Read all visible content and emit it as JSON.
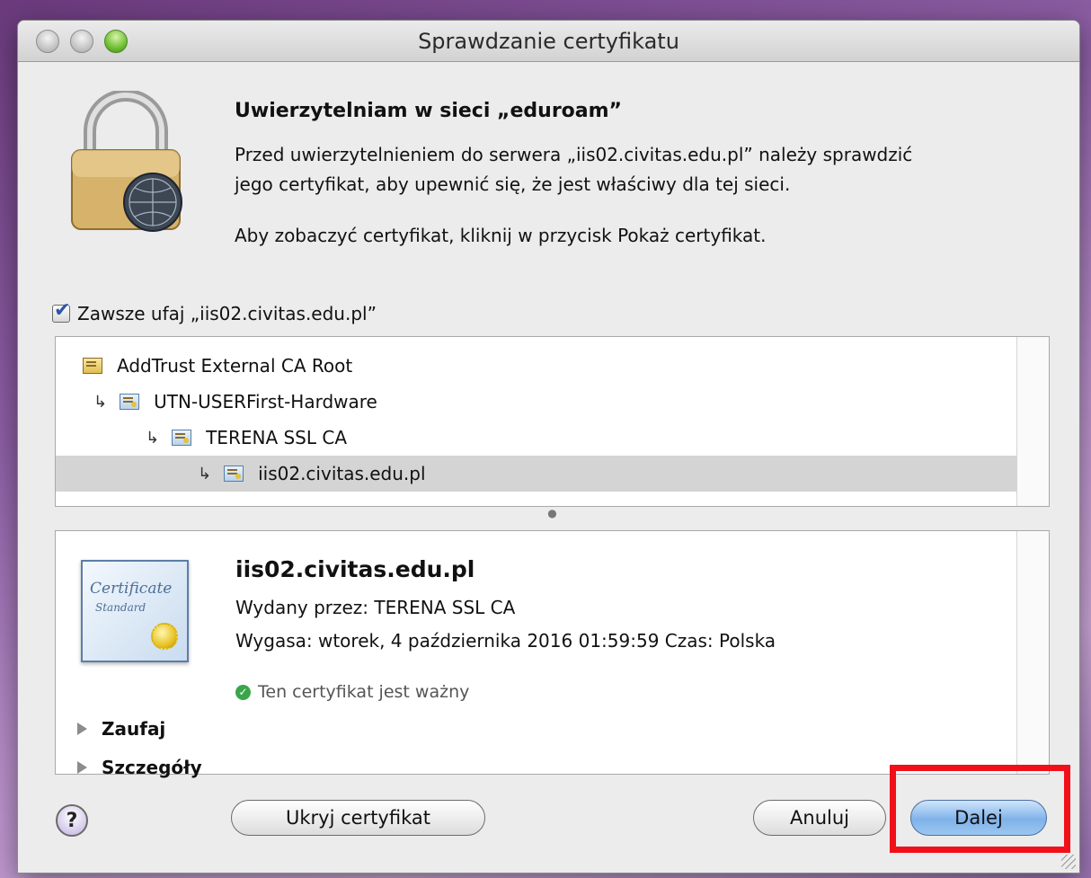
{
  "window": {
    "title": "Sprawdzanie certyfikatu"
  },
  "header": {
    "heading": "Uwierzytelniam w sieci „eduroam”",
    "description_line1": "Przed uwierzytelnieniem do serwera „iis02.civitas.edu.pl” należy sprawdzić",
    "description_line2": "jego certyfikat, aby upewnić się, że jest właściwy dla tej sieci.",
    "instruction": "Aby zobaczyć certyfikat, kliknij w przycisk Pokaż certyfikat."
  },
  "trust_checkbox": {
    "label": "Zawsze ufaj „iis02.civitas.edu.pl”",
    "checked": true
  },
  "cert_chain": [
    {
      "label": "AddTrust External CA Root",
      "selected": false
    },
    {
      "label": "UTN-USERFirst-Hardware",
      "selected": false
    },
    {
      "label": "TERENA SSL CA",
      "selected": false
    },
    {
      "label": "iis02.civitas.edu.pl",
      "selected": true
    }
  ],
  "detail": {
    "cert_image_text1": "Certificate",
    "cert_image_text2": "Standard",
    "name": "iis02.civitas.edu.pl",
    "issued_by": "Wydany przez: TERENA SSL CA",
    "expires": "Wygasa: wtorek, 4 października 2016 01:59:59 Czas: Polska",
    "status": "Ten certyfikat jest ważny",
    "status_color": "#3aa64a",
    "sections": [
      "Zaufaj",
      "Szczegóły"
    ]
  },
  "buttons": {
    "help": "?",
    "hide_cert": "Ukryj certyfikat",
    "cancel": "Anuluj",
    "next": "Dalej"
  },
  "highlight_color": "#f1101a"
}
